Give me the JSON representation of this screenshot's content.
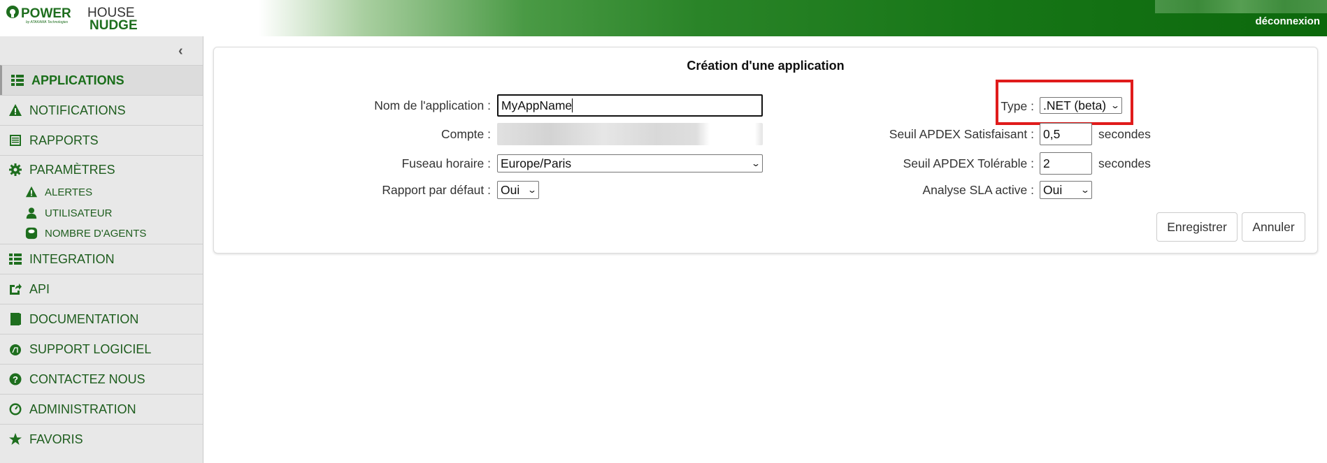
{
  "header": {
    "logo_text": "POWERHOUSE NUDGE",
    "logo_sub": "by ATAKAMA Technologies",
    "logout": "déconnexion"
  },
  "sidebar": {
    "items": [
      {
        "label": "APPLICATIONS",
        "icon": "list-icon"
      },
      {
        "label": "NOTIFICATIONS",
        "icon": "warning-icon"
      },
      {
        "label": "RAPPORTS",
        "icon": "report-icon"
      },
      {
        "label": "PARAMÈTRES",
        "icon": "gear-icon"
      },
      {
        "label": "INTEGRATION",
        "icon": "list-icon"
      },
      {
        "label": "API",
        "icon": "share-icon"
      },
      {
        "label": "DOCUMENTATION",
        "icon": "book-icon"
      },
      {
        "label": "SUPPORT LOGICIEL",
        "icon": "support-icon"
      },
      {
        "label": "CONTACTEZ NOUS",
        "icon": "question-icon"
      },
      {
        "label": "ADMINISTRATION",
        "icon": "dashboard-icon"
      },
      {
        "label": "FAVORIS",
        "icon": "star-icon"
      }
    ],
    "sub_items": [
      {
        "label": "ALERTES",
        "icon": "warning-icon"
      },
      {
        "label": "UTILISATEUR",
        "icon": "user-icon"
      },
      {
        "label": "NOMBRE D'AGENTS",
        "icon": "agent-icon"
      }
    ]
  },
  "form": {
    "title": "Création d'une application",
    "name_label": "Nom de l'application :",
    "name_value": "MyAppName",
    "account_label": "Compte :",
    "timezone_label": "Fuseau horaire :",
    "timezone_value": "Europe/Paris",
    "report_label": "Rapport par défaut :",
    "report_value": "Oui",
    "type_label": "Type :",
    "type_value": ".NET (beta)",
    "apdex_sat_label": "Seuil APDEX Satisfaisant :",
    "apdex_sat_value": "0,5",
    "apdex_tol_label": "Seuil APDEX Tolérable :",
    "apdex_tol_value": "2",
    "unit": "secondes",
    "sla_label": "Analyse SLA active :",
    "sla_value": "Oui",
    "save": "Enregistrer",
    "cancel": "Annuler"
  },
  "colors": {
    "brand": "#1e6e1e",
    "highlight": "#e01b1b"
  }
}
